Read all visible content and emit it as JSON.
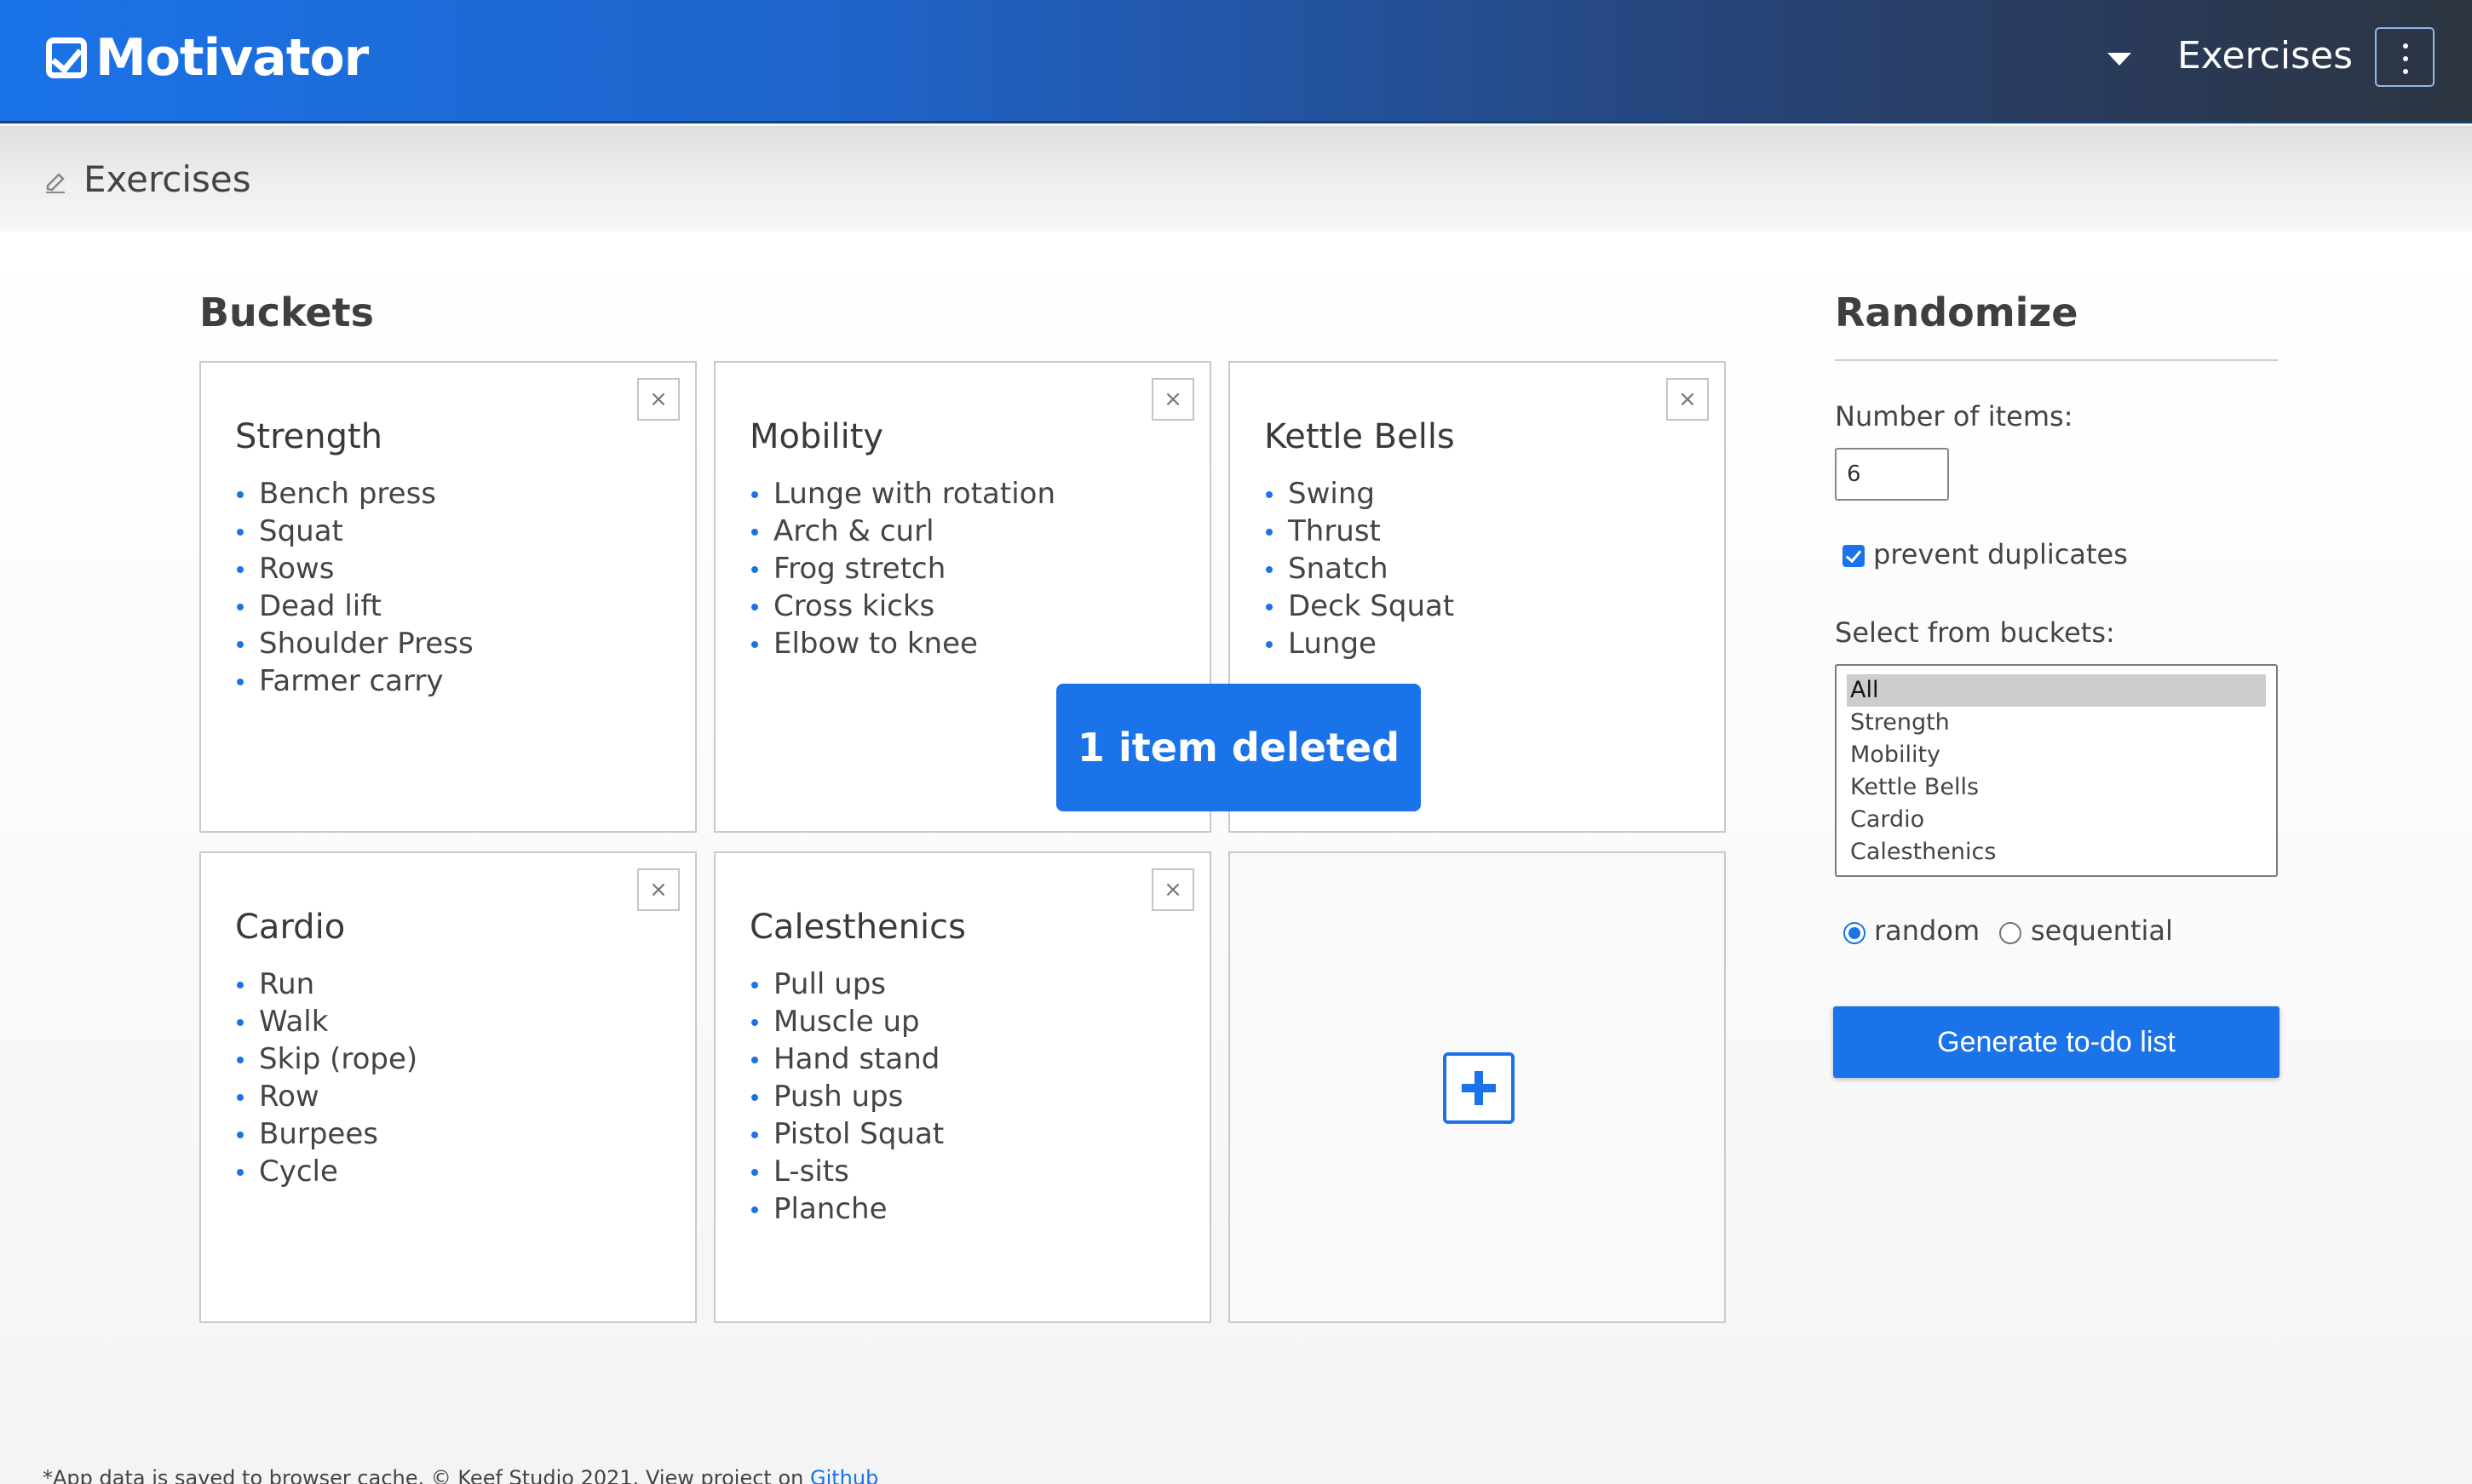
{
  "header": {
    "brand": "Motivator",
    "nav_label": "Exercises"
  },
  "breadcrumb": {
    "title": "Exercises"
  },
  "buckets": {
    "heading": "Buckets",
    "items": [
      {
        "title": "Strength",
        "exercises": [
          "Bench press",
          "Squat",
          "Rows",
          "Dead lift",
          "Shoulder Press",
          "Farmer carry"
        ]
      },
      {
        "title": "Mobility",
        "exercises": [
          "Lunge with rotation",
          "Arch & curl",
          "Frog stretch",
          "Cross kicks",
          "Elbow to knee"
        ]
      },
      {
        "title": "Kettle Bells",
        "exercises": [
          "Swing",
          "Thrust",
          "Snatch",
          "Deck Squat",
          "Lunge"
        ]
      },
      {
        "title": "Cardio",
        "exercises": [
          "Run",
          "Walk",
          "Skip (rope)",
          "Row",
          "Burpees",
          "Cycle"
        ]
      },
      {
        "title": "Calesthenics",
        "exercises": [
          "Pull ups",
          "Muscle up",
          "Hand stand",
          "Push ups",
          "Pistol Squat",
          "L-sits",
          "Planche"
        ]
      }
    ],
    "close_symbol": "×"
  },
  "toast": {
    "message": "1 item deleted"
  },
  "randomize": {
    "heading": "Randomize",
    "number_label": "Number of items:",
    "number_value": "6",
    "prevent_duplicates_label": "prevent duplicates",
    "prevent_duplicates_checked": true,
    "select_label": "Select from buckets:",
    "options": [
      "All",
      "Strength",
      "Mobility",
      "Kettle Bells",
      "Cardio",
      "Calesthenics"
    ],
    "selected_option": "All",
    "mode_random_label": "random",
    "mode_sequential_label": "sequential",
    "mode_selected": "random",
    "generate_label": "Generate to-do list"
  },
  "footer": {
    "text": "*App data is saved to browser cache. © Keef Studio 2021. View project on",
    "link_label": "Github"
  },
  "colors": {
    "accent": "#1a73e8",
    "header_dark": "#2c3440"
  }
}
